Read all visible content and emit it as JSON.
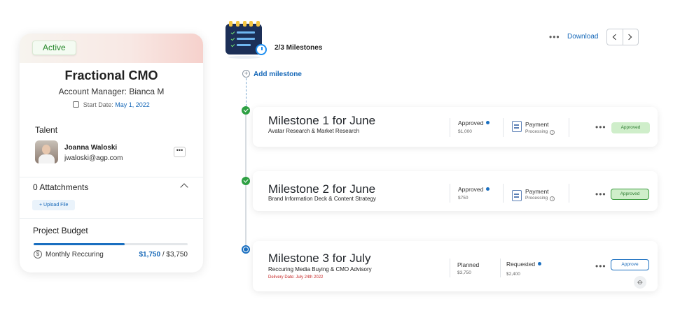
{
  "project": {
    "status": "Active",
    "title": "Fractional CMO",
    "account_manager": "Account Manager: Bianca M",
    "start_date_label": "Start Date:",
    "start_date": "May 1, 2022",
    "talent_heading": "Talent",
    "talent": {
      "name": "Joanna Waloski",
      "email": "jwaloski@agp.com"
    },
    "attachments_heading": "0 Attatchments",
    "upload_label": "+ Upload File",
    "budget_heading": "Project Budget",
    "budget_type": "Monthly Reccuring",
    "budget_spent": "$1,750",
    "budget_sep": " / ",
    "budget_total": "$3,750",
    "budget_progress": 0.59
  },
  "header": {
    "milestones_count": "2/3 Milestones",
    "add_milestone": "Add milestone",
    "more": "•••",
    "download": "Download"
  },
  "milestones": [
    {
      "title": "Milestone 1 for June",
      "subtitle": "Avatar Research & Market Research",
      "status_label": "Approved",
      "amount": "$1,000",
      "payment_label": "Payment",
      "payment_status": "Processing",
      "more": "•••",
      "action": "Approved"
    },
    {
      "title": "Milestone 2 for June",
      "subtitle": "Brand Information Deck & Content Strategy",
      "status_label": "Approved",
      "amount": "$750",
      "payment_label": "Payment",
      "payment_status": "Processing",
      "more": "•••",
      "action": "Approved"
    },
    {
      "title": "Milestone 3 for July",
      "subtitle": "Reccuring Media Buying & CMO Advisory",
      "delivery": "Delivery Date: July 24th 2022",
      "status_label": "Planned",
      "amount": "$3,750",
      "requested_label": "Requested",
      "requested_amount": "$2,400",
      "more": "•••",
      "action": "Approve"
    }
  ],
  "colors": {
    "accent_blue": "#1668b8",
    "success_green": "#2ea043",
    "approved_bg": "#cfeeca",
    "delivery_red": "#c62828"
  }
}
